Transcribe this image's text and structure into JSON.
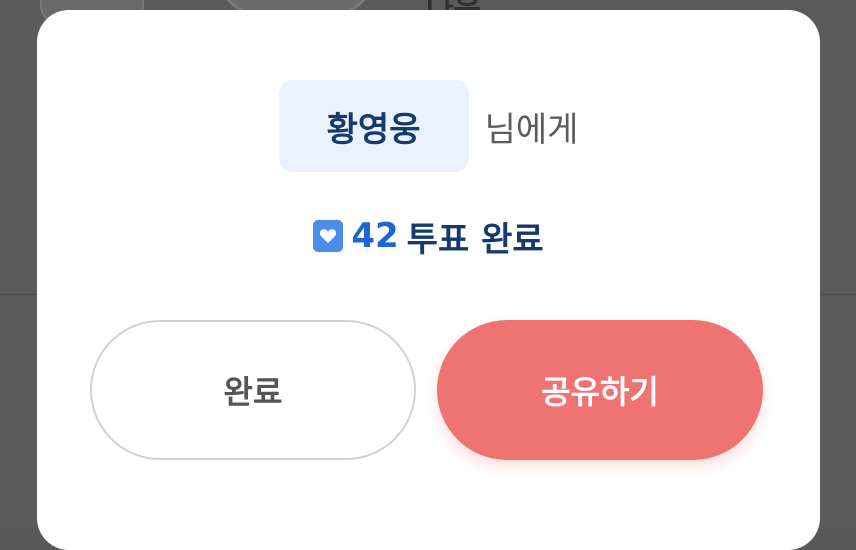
{
  "background": {
    "name_fragment": "나윤"
  },
  "dialog": {
    "recipient_name": "황영웅",
    "recipient_suffix": "님에게",
    "vote_count": "42",
    "vote_label": "투표 완료",
    "done_button_label": "완료",
    "share_button_label": "공유하기",
    "vote_icon": "heart-ticket-icon"
  },
  "colors": {
    "accent_blue": "#1f64d6",
    "navy_text": "#163a6e",
    "chip_background": "#eaf2fd",
    "share_button": "#f07374",
    "overlay": "#595959"
  }
}
